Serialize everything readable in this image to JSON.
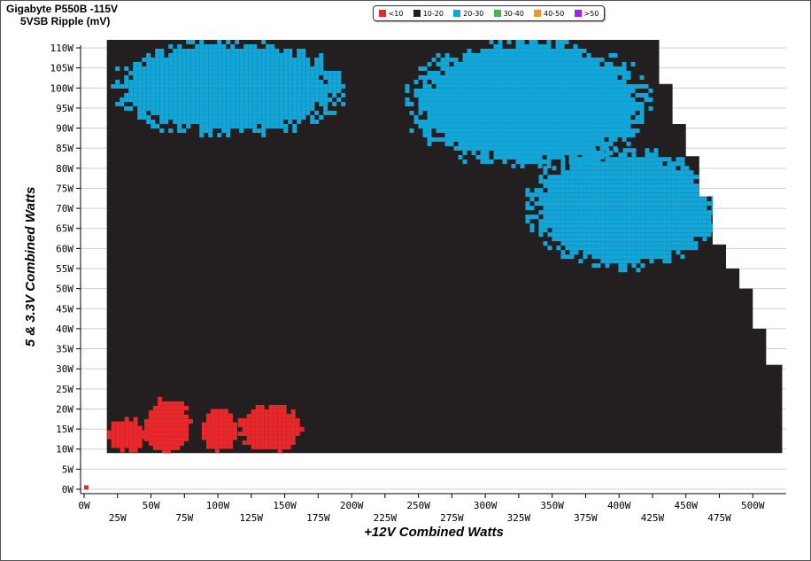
{
  "title": "Gigabyte P550B -115V",
  "subtitle": "5VSB Ripple (mV)",
  "legend": [
    {
      "label": "<10",
      "color": "#e8282b"
    },
    {
      "label": "10-20",
      "color": "#231f20"
    },
    {
      "label": "20-30",
      "color": "#13a6d8"
    },
    {
      "label": "30-40",
      "color": "#4cb050"
    },
    {
      "label": "40-50",
      "color": "#f39424"
    },
    {
      "label": ">50",
      "color": "#a020f0"
    }
  ],
  "chart_data": {
    "type": "heatmap",
    "title": "Gigabyte P550B -115V",
    "subtitle": "5VSB Ripple (mV)",
    "xlabel": "+12V Combined Watts",
    "ylabel": "5 & 3.3V Combined Watts",
    "xlim": [
      0,
      525
    ],
    "ylim": [
      0,
      110
    ],
    "x_ticks": [
      "0W",
      "25W",
      "50W",
      "75W",
      "100W",
      "125W",
      "150W",
      "175W",
      "200W",
      "225W",
      "250W",
      "275W",
      "300W",
      "325W",
      "350W",
      "375W",
      "400W",
      "425W",
      "450W",
      "475W",
      "500W"
    ],
    "y_ticks": [
      "0W",
      "5W",
      "10W",
      "15W",
      "20W",
      "25W",
      "30W",
      "35W",
      "40W",
      "45W",
      "50W",
      "55W",
      "60W",
      "65W",
      "70W",
      "75W",
      "80W",
      "85W",
      "90W",
      "95W",
      "100W",
      "105W",
      "110W"
    ],
    "grid": true,
    "categories": [
      "<10",
      "10-20",
      "20-30",
      "30-40",
      "40-50",
      ">50"
    ],
    "base_fill": "10-20",
    "operating_envelope": [
      {
        "x": 17,
        "y_max": 112
      },
      {
        "x": 425,
        "y_max": 112
      },
      {
        "x": 430,
        "y_max": 101
      },
      {
        "x": 440,
        "y_max": 91
      },
      {
        "x": 450,
        "y_max": 83
      },
      {
        "x": 460,
        "y_max": 73
      },
      {
        "x": 470,
        "y_max": 61
      },
      {
        "x": 480,
        "y_max": 55
      },
      {
        "x": 490,
        "y_max": 50
      },
      {
        "x": 500,
        "y_max": 40
      },
      {
        "x": 510,
        "y_max": 31
      },
      {
        "x": 522,
        "y_max": 31
      }
    ],
    "regions": [
      {
        "band": "<10",
        "x_range": [
          17,
          45
        ],
        "y_range": [
          9,
          18
        ]
      },
      {
        "band": "<10",
        "x_range": [
          45,
          80
        ],
        "y_range": [
          9,
          23
        ]
      },
      {
        "band": "<10",
        "x_range": [
          88,
          115
        ],
        "y_range": [
          9,
          20
        ]
      },
      {
        "band": "<10",
        "x_range": [
          115,
          165
        ],
        "y_range": [
          9,
          21
        ]
      },
      {
        "band": "<10",
        "x_range": [
          0,
          2
        ],
        "y_range": [
          0,
          1
        ]
      },
      {
        "band": "20-30",
        "x_range": [
          240,
          425
        ],
        "y_range": [
          80,
          112
        ]
      },
      {
        "band": "20-30",
        "x_range": [
          330,
          480
        ],
        "y_range": [
          55,
          85
        ]
      },
      {
        "band": "20-30",
        "x_range": [
          20,
          195
        ],
        "y_range": [
          88,
          112
        ]
      }
    ]
  },
  "axes": {
    "x_title": "+12V Combined Watts",
    "y_title": "5 & 3.3V Combined Watts"
  }
}
